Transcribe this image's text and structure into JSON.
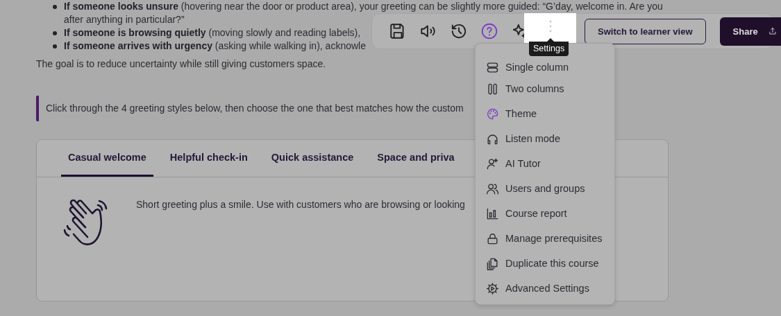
{
  "lesson": {
    "bullets": [
      {
        "text": "**If someone looks unsure** (hovering near the door or product area), your greeting can be slightly more guided: “G’day, welcome in. Are you after anything in particular?”"
      },
      {
        "text": "**If someone is browsing quietly** (moving slowly and reading labels),"
      },
      {
        "text": "**If someone arrives with urgency** (asking while walking in), acknowle"
      }
    ],
    "summary": "The goal is to reduce uncertainty while still giving customers space.",
    "callout": "Click through the 4 greeting styles below, then choose the one that best matches how the custom",
    "tabs": [
      {
        "label": "Casual welcome",
        "selected": true
      },
      {
        "label": "Helpful check-in",
        "selected": false
      },
      {
        "label": "Quick assistance",
        "selected": false
      },
      {
        "label": "Space and priva",
        "selected": false
      }
    ],
    "panel": {
      "text": "Short greeting plus a smile. Use with customers who are browsing or looking"
    }
  },
  "toolbar": {
    "tools": [
      {
        "kind": "save",
        "selected": false
      },
      {
        "kind": "audio",
        "selected": false
      },
      {
        "kind": "history",
        "selected": false
      },
      {
        "kind": "help",
        "selected": true
      },
      {
        "kind": "ai",
        "selected": false
      },
      {
        "kind": "more",
        "selected": true
      }
    ],
    "tooltip": "Settings",
    "learner_button": "Switch to learner view",
    "share_button": "Share"
  },
  "menu": {
    "items": [
      {
        "kind": "rows",
        "label": "Single column"
      },
      {
        "kind": "columns",
        "label": "Two columns"
      },
      {
        "kind": "palette",
        "label": "Theme"
      },
      {
        "kind": "headphones",
        "label": "Listen mode"
      },
      {
        "kind": "tutor",
        "label": "AI Tutor"
      },
      {
        "kind": "users",
        "label": "Users and groups"
      },
      {
        "kind": "chart",
        "label": "Course report"
      },
      {
        "kind": "lock",
        "label": "Manage prerequisites"
      },
      {
        "kind": "copy",
        "label": "Duplicate this course"
      },
      {
        "kind": "gear",
        "label": "Advanced Settings"
      }
    ]
  }
}
